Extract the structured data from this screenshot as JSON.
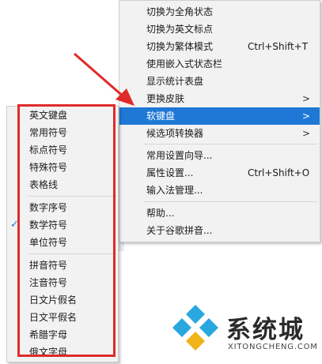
{
  "main_menu": [
    {
      "label": "切换为全角状态",
      "shortcut": "",
      "arrow": ""
    },
    {
      "label": "切换为英文标点",
      "shortcut": "",
      "arrow": ""
    },
    {
      "label": "切换为繁体模式",
      "shortcut": "Ctrl+Shift+T",
      "arrow": ""
    },
    {
      "label": "使用嵌入式状态栏",
      "shortcut": "",
      "arrow": ""
    },
    {
      "label": "显示统计表盘",
      "shortcut": "",
      "arrow": ""
    },
    {
      "label": "更换皮肤",
      "shortcut": "",
      "arrow": ">"
    },
    {
      "label": "软键盘",
      "shortcut": "",
      "arrow": ">"
    },
    {
      "label": "候选项转换器",
      "shortcut": "",
      "arrow": ">"
    },
    {
      "label": "常用设置向导...",
      "shortcut": "",
      "arrow": ""
    },
    {
      "label": "属性设置...",
      "shortcut": "Ctrl+Shift+O",
      "arrow": ""
    },
    {
      "label": "输入法管理...",
      "shortcut": "",
      "arrow": ""
    },
    {
      "label": "帮助...",
      "shortcut": "",
      "arrow": ""
    },
    {
      "label": "关于谷歌拼音...",
      "shortcut": "",
      "arrow": ""
    }
  ],
  "submenu": [
    {
      "label": "英文键盘",
      "check": ""
    },
    {
      "label": "常用符号",
      "check": ""
    },
    {
      "label": "标点符号",
      "check": ""
    },
    {
      "label": "特殊符号",
      "check": ""
    },
    {
      "label": "表格线",
      "check": ""
    },
    {
      "label": "数字序号",
      "check": ""
    },
    {
      "label": "数学符号",
      "check": "✓"
    },
    {
      "label": "单位符号",
      "check": ""
    },
    {
      "label": "拼音符号",
      "check": ""
    },
    {
      "label": "注音符号",
      "check": ""
    },
    {
      "label": "日文片假名",
      "check": ""
    },
    {
      "label": "日文平假名",
      "check": ""
    },
    {
      "label": "希腊字母",
      "check": ""
    },
    {
      "label": "俄文字母",
      "check": ""
    }
  ],
  "logo": {
    "name": "系统城",
    "url": "XITONGCHENG.COM"
  },
  "colors": {
    "highlight": "#1f78d6",
    "annotation": "#e02a2a"
  }
}
